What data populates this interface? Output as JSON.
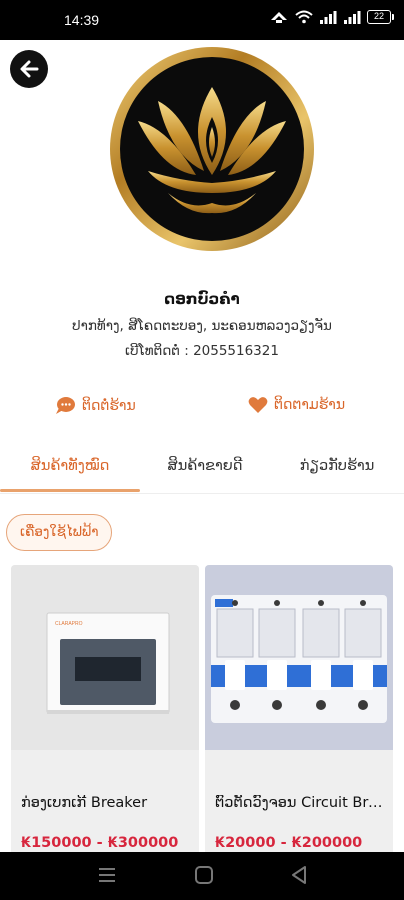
{
  "status_bar": {
    "time": "14:39",
    "battery": "22"
  },
  "shop": {
    "name": "ດອກບົວຄຳ",
    "address": "ປາກທ້າງ, ສີໂຄດຕະບອງ, ນະຄອນຫລວງວຽງຈັນ",
    "phone": "ເບີໂທຕິດຕໍ່ : 2055516321"
  },
  "actions": {
    "contact": "ຕິດຕໍ່ຮ້ານ",
    "follow": "ຕິດຕາມຮ້ານ"
  },
  "tabs": [
    {
      "label": "ສິນຄ້າທັງໝົດ",
      "active": true
    },
    {
      "label": "ສິນຄ້າຂາຍດີ",
      "active": false
    },
    {
      "label": "ກ່ຽວກັບຮ້ານ",
      "active": false
    }
  ],
  "category_chip": "ເຄື່ອງໃຊ້ໄຟຟ້າ",
  "products": [
    {
      "name": "ກ່ອງເບກເກີ Breaker",
      "price": "₭150000 - ₭300000"
    },
    {
      "name": "ຕົວຕັດວົງຈອນ Circuit Breaker",
      "price": "₭20000 - ₭200000"
    }
  ],
  "colors": {
    "accent": "#d9662a",
    "price": "#d7263d",
    "gold": "#c99a3b"
  }
}
